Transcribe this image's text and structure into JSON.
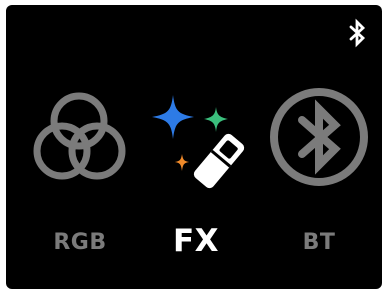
{
  "status_bar": {
    "bluetooth_icon": "bluetooth-icon"
  },
  "modes": [
    {
      "id": "rgb",
      "label": "RGB",
      "icon": "rgb-circles-icon",
      "selected": false
    },
    {
      "id": "fx",
      "label": "FX",
      "icon": "fx-sparkle-wand-icon",
      "selected": true
    },
    {
      "id": "bt",
      "label": "BT",
      "icon": "bluetooth-circle-icon",
      "selected": false
    }
  ],
  "colors": {
    "background": "#000000",
    "inactive": "#7b7b7b",
    "active": "#ffffff",
    "sparkle_blue": "#2d7be6",
    "sparkle_green": "#3bbf7d",
    "sparkle_orange": "#f08a2a"
  }
}
